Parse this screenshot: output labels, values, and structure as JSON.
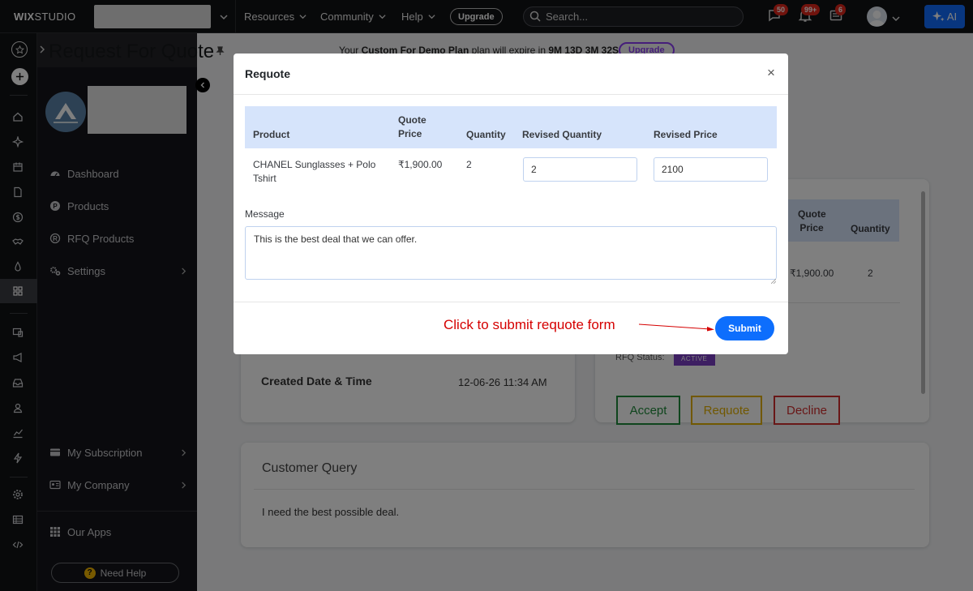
{
  "topbar": {
    "logo_bold": "WIX",
    "logo_rest": "STUDIO",
    "menus": [
      "Resources",
      "Community",
      "Help"
    ],
    "upgrade_label": "Upgrade",
    "search_placeholder": "Search...",
    "badges": {
      "messages": "50",
      "notifications": "99+",
      "updates": "6"
    },
    "ai_label": "AI"
  },
  "page": {
    "title": "Request For Quote",
    "notice_prefix": "Your ",
    "notice_plan": "Custom For Demo Plan",
    "notice_mid": " plan will expire in ",
    "notice_time": "9M 13D 3M 32S",
    "notice_upgrade": "Upgrade"
  },
  "sidebar": {
    "items": [
      {
        "label": "Dashboard"
      },
      {
        "label": "Products"
      },
      {
        "label": "RFQ Products"
      },
      {
        "label": "Settings"
      }
    ],
    "bottom_items": [
      {
        "label": "My Subscription"
      },
      {
        "label": "My Company"
      },
      {
        "label": "Our Apps"
      }
    ],
    "need_help": "Need Help"
  },
  "background": {
    "created_label": "Created Date & Time",
    "created_value": "12-06-26 11:34 AM",
    "right_headers": {
      "quote_price": "Quote Price",
      "quantity": "Quantity"
    },
    "right_values": {
      "quote_price": "₹1,900.00",
      "quantity": "2"
    },
    "rfq_status_label": "RFQ Status:",
    "rfq_status_value": "ACTIVE",
    "actions": {
      "accept": "Accept",
      "requote": "Requote",
      "decline": "Decline"
    },
    "customer_query_title": "Customer Query",
    "customer_query_text": "I need the best possible deal."
  },
  "modal": {
    "title": "Requote",
    "close": "×",
    "headers": {
      "product": "Product",
      "quote_price": "Quote Price",
      "quantity": "Quantity",
      "revised_quantity": "Revised Quantity",
      "revised_price": "Revised Price"
    },
    "row": {
      "product": "CHANEL Sunglasses + Polo Tshirt",
      "quote_price": "₹1,900.00",
      "quantity": "2",
      "revised_quantity": "2",
      "revised_price": "2100"
    },
    "message_label": "Message",
    "message_value": "This is the best deal that we can offer.",
    "submit": "Submit",
    "annotation": "Click to submit requote form"
  },
  "colors": {
    "accent": "#0d6efd",
    "table_header": "#d6e4fb",
    "annotation": "#d50000",
    "accept": "#1f8a3a",
    "requote": "#e3b100",
    "decline": "#d32f2f",
    "status_badge": "#7b3fc4"
  }
}
